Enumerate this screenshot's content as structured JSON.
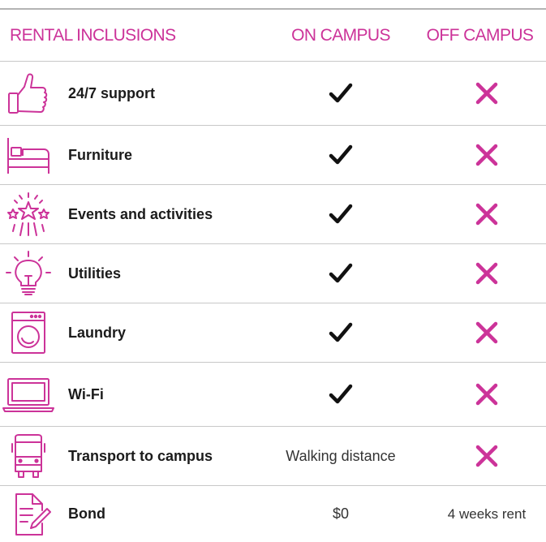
{
  "colors": {
    "accent": "#cc3399",
    "text": "#1b1b1b",
    "rule": "#c8c8c8"
  },
  "header": {
    "inclusions": "RENTAL INCLUSIONS",
    "on_campus": "ON CAMPUS",
    "off_campus": "OFF CAMPUS"
  },
  "rows": [
    {
      "icon": "thumbs-up-icon",
      "label": "24/7 support",
      "on_campus": "check",
      "off_campus": "cross"
    },
    {
      "icon": "bed-icon",
      "label": "Furniture",
      "on_campus": "check",
      "off_campus": "cross"
    },
    {
      "icon": "fireworks-icon",
      "label": "Events and activities",
      "on_campus": "check",
      "off_campus": "cross"
    },
    {
      "icon": "lightbulb-icon",
      "label": "Utilities",
      "on_campus": "check",
      "off_campus": "cross"
    },
    {
      "icon": "washing-machine-icon",
      "label": "Laundry",
      "on_campus": "check",
      "off_campus": "cross"
    },
    {
      "icon": "laptop-icon",
      "label": "Wi-Fi",
      "on_campus": "check",
      "off_campus": "cross"
    },
    {
      "icon": "bus-icon",
      "label": "Transport to campus",
      "on_campus": "Walking distance",
      "off_campus": "cross"
    },
    {
      "icon": "document-pen-icon",
      "label": "Bond",
      "on_campus": "$0",
      "off_campus": "4 weeks rent"
    }
  ]
}
